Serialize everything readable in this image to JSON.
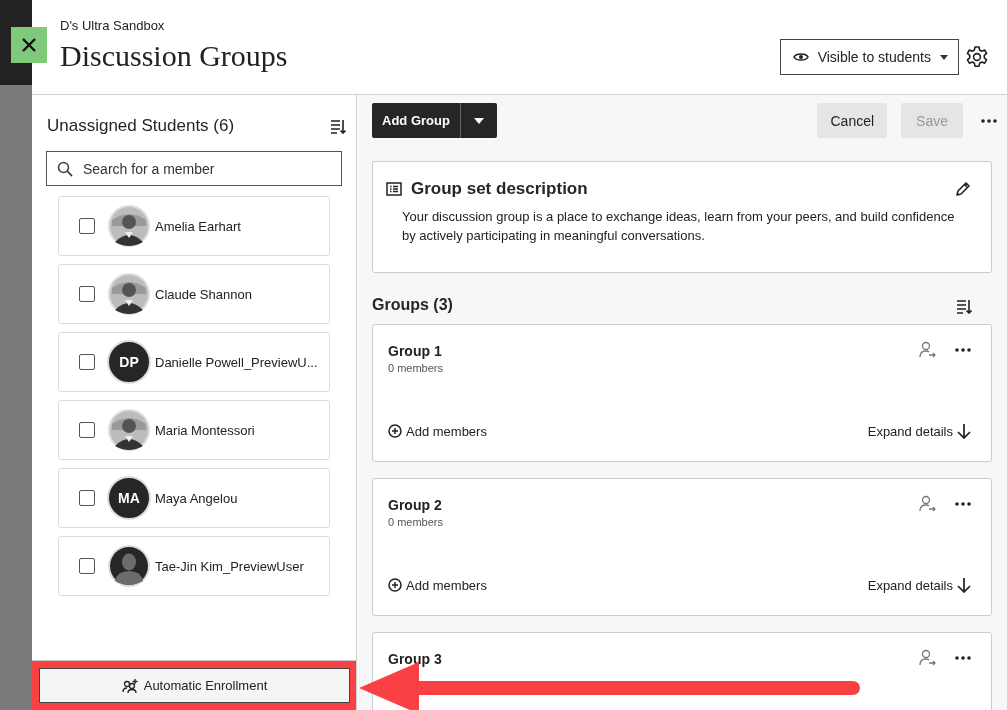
{
  "course": "D's Ultra Sandbox",
  "title": "Discussion Groups",
  "visibility": "Visible to students",
  "unassigned": {
    "heading": "Unassigned Students (6)",
    "search": {
      "placeholder": "Search for a member"
    },
    "students": [
      {
        "name": "Amelia Earhart",
        "checked": false
      },
      {
        "name": "Claude Shannon",
        "checked": false
      },
      {
        "name": "Danielle Powell_PreviewU...",
        "checked": false,
        "avatar": {
          "kind": "initials",
          "text": "DP"
        }
      },
      {
        "name": "Maria Montessori",
        "checked": false
      },
      {
        "name": "Maya Angelou",
        "checked": false,
        "avatar": {
          "kind": "initials",
          "text": "MA"
        }
      },
      {
        "name": "Tae-Jin Kim_PreviewUser",
        "checked": false,
        "avatar": {
          "kind": "default"
        }
      }
    ]
  },
  "footer_button": "Automatic Enrollment",
  "toolbar": {
    "add_group": "Add Group",
    "cancel": "Cancel",
    "save": {
      "label": "Save",
      "disabled": true
    }
  },
  "description": {
    "title": "Group set description",
    "text": "Your discussion group is a place to exchange ideas, learn from your peers, and build confidence by actively participating in meaningful conversations."
  },
  "groups_heading": "Groups (3)",
  "groups": [
    {
      "name": "Group 1",
      "members": "0 members",
      "add_label": "Add members",
      "expand_label": "Expand details"
    },
    {
      "name": "Group 2",
      "members": "0 members",
      "add_label": "Add members",
      "expand_label": "Expand details"
    },
    {
      "name": "Group 3"
    }
  ]
}
